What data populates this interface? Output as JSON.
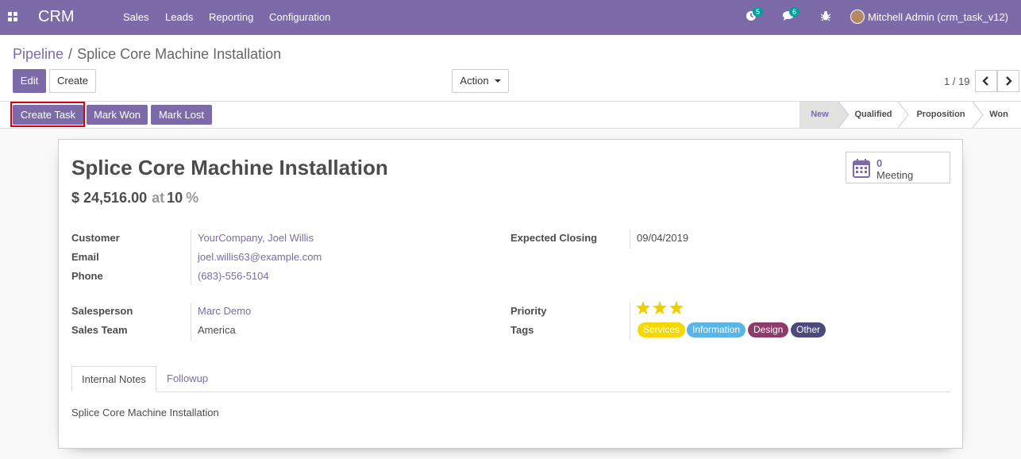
{
  "navbar": {
    "brand": "CRM",
    "menu": [
      "Sales",
      "Leads",
      "Reporting",
      "Configuration"
    ],
    "activity_count": "5",
    "message_count": "6",
    "user": "Mitchell Admin (crm_task_v12)",
    "icons": [
      "apps-icon",
      "clock-icon",
      "chat-icon",
      "bug-icon"
    ]
  },
  "breadcrumb": {
    "parent": "Pipeline",
    "separator": "/",
    "current": "Splice Core Machine Installation"
  },
  "toolbar": {
    "edit_label": "Edit",
    "create_label": "Create",
    "action_label": "Action",
    "pager_value": "1 / 19"
  },
  "statusbar": {
    "create_task_label": "Create Task",
    "mark_won_label": "Mark Won",
    "mark_lost_label": "Mark Lost",
    "stages": [
      "New",
      "Qualified",
      "Proposition",
      "Won"
    ],
    "active_stage": "New"
  },
  "lead": {
    "title": "Splice Core Machine Installation",
    "amount": "$ 24,516.00",
    "at_label": "at",
    "probability": "10",
    "percent_sign": "%",
    "meeting_count": "0",
    "meeting_label": "Meeting",
    "fields": {
      "customer_label": "Customer",
      "customer_value": "YourCompany, Joel Willis",
      "email_label": "Email",
      "email_value": "joel.willis63@example.com",
      "phone_label": "Phone",
      "phone_value": "(683)-556-5104",
      "expected_closing_label": "Expected Closing",
      "expected_closing_value": "09/04/2019",
      "salesperson_label": "Salesperson",
      "salesperson_value": "Marc Demo",
      "sales_team_label": "Sales Team",
      "sales_team_value": "America",
      "priority_label": "Priority",
      "priority_stars": 3,
      "tags_label": "Tags"
    },
    "tags": [
      {
        "label": "Services",
        "color": "#f4d800"
      },
      {
        "label": "Information",
        "color": "#5ab4e6"
      },
      {
        "label": "Design",
        "color": "#8e3a6a"
      },
      {
        "label": "Other",
        "color": "#4b4a7a"
      }
    ],
    "tabs": [
      "Internal Notes",
      "Followup"
    ],
    "notes": "Splice Core Machine Installation"
  },
  "colors": {
    "brand": "#7c6ba8",
    "highlight": "#d9000d",
    "star": "#f3cc00"
  }
}
